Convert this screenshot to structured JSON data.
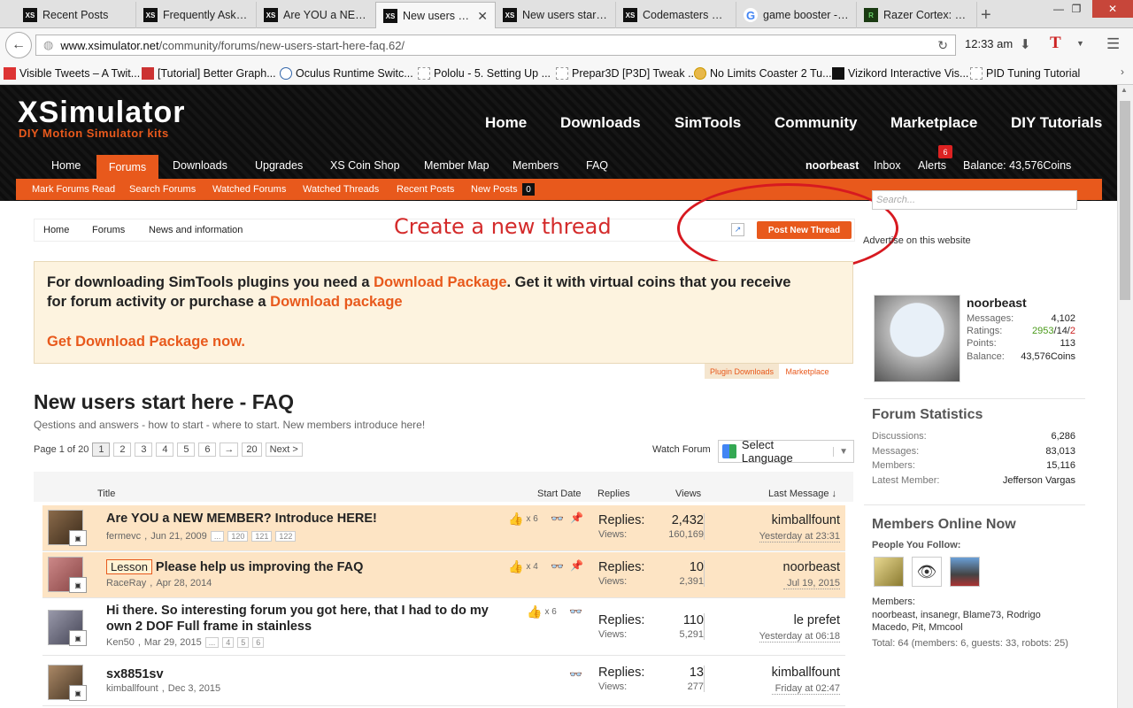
{
  "browser": {
    "tabs": [
      {
        "label": "Recent Posts",
        "icon": "XS"
      },
      {
        "label": "Frequently Aske...",
        "icon": "XS"
      },
      {
        "label": "Are YOU a NEW ...",
        "icon": "XS"
      },
      {
        "label": "New users s...",
        "icon": "XS",
        "active": true
      },
      {
        "label": "New users start ...",
        "icon": "XS"
      },
      {
        "label": "Codemasters Di...",
        "icon": "XS"
      },
      {
        "label": "game booster - ...",
        "icon": "G"
      },
      {
        "label": "Razer Cortex: Ga...",
        "icon": "R"
      }
    ],
    "url_domain": "www.xsimulator.net",
    "url_path": "/community/forums/new-users-start-here-faq.62/",
    "time": "12:33 am",
    "bookmarks": [
      "Visible Tweets – A Twit...",
      "[Tutorial] Better Graph...",
      "Oculus Runtime Switc...",
      "Pololu - 5. Setting Up ...",
      "Prepar3D [P3D] Tweak ...",
      "No Limits Coaster 2 Tu...",
      "Vizikord Interactive Vis...",
      "PID Tuning Tutorial"
    ]
  },
  "site": {
    "logo": "XSimulator",
    "tagline": "DIY Motion Simulator kits",
    "topnav": [
      "Home",
      "Downloads",
      "SimTools",
      "Community",
      "Marketplace",
      "DIY Tutorials"
    ],
    "subnav": [
      "Home",
      "Forums",
      "Downloads",
      "Upgrades",
      "XS Coin Shop",
      "Member Map",
      "Members",
      "FAQ"
    ],
    "user": "noorbeast",
    "inbox": "Inbox",
    "alerts": "Alerts",
    "alerts_count": "6",
    "balance": "Balance: 43,576Coins",
    "orange_links": [
      "Mark Forums Read",
      "Search Forums",
      "Watched Forums",
      "Watched Threads",
      "Recent Posts",
      "New Posts"
    ],
    "new_posts_count": "0"
  },
  "breadcrumb": [
    "Home",
    "Forums",
    "News and information"
  ],
  "annotation": "Create a new thread",
  "post_new_thread": "Post New Thread",
  "notice": {
    "line1_a": "For downloading SimTools plugins you need a ",
    "line1_link": "Download Package",
    "line1_b": ". Get it with virtual coins that you receive",
    "line2_a": "for forum activity or purchase a ",
    "line2_link": "Download package",
    "line3": "Get Download Package now.",
    "tab1": "Plugin Downloads",
    "tab2": "Marketplace"
  },
  "forum": {
    "title": "New users start here - FAQ",
    "description": "Qestions and answers - how to start - where to start. New members introduce here!",
    "page_info": "Page 1 of 20",
    "pages": [
      "1",
      "2",
      "3",
      "4",
      "5",
      "6",
      "→",
      "20",
      "Next >"
    ],
    "watch": "Watch Forum",
    "language": "Select Language",
    "columns": {
      "title": "Title",
      "start_date": "Start Date",
      "replies": "Replies",
      "views": "Views",
      "last": "Last Message ↓"
    }
  },
  "threads": [
    {
      "title": "Are YOU a NEW MEMBER? Introduce HERE!",
      "prefix": "",
      "line2": "",
      "author": "fermevc",
      "date": "Jun 21, 2009",
      "pages": [
        "...",
        "120",
        "121",
        "122"
      ],
      "likes": "x 6",
      "replies_label": "Replies:",
      "replies": "2,432",
      "views_label": "Views:",
      "views": "160,169",
      "last_user": "kimballfount",
      "last_date": "Yesterday at 23:31",
      "sticky": true
    },
    {
      "title": "Please help us improving the FAQ",
      "prefix": "Lesson",
      "line2": "",
      "author": "RaceRay",
      "date": "Apr 28, 2014",
      "pages": [],
      "likes": "x 4",
      "replies_label": "Replies:",
      "replies": "10",
      "views_label": "Views:",
      "views": "2,391",
      "last_user": "noorbeast",
      "last_date": "Jul 19, 2015",
      "sticky": true
    },
    {
      "title": "Hi there. So interesting forum you got here, that I had to do my",
      "prefix": "",
      "line2": "own 2 DOF Full frame in stainless",
      "author": "Ken50",
      "date": "Mar 29, 2015",
      "pages": [
        "...",
        "4",
        "5",
        "6"
      ],
      "likes": "x 6",
      "replies_label": "Replies:",
      "replies": "110",
      "views_label": "Views:",
      "views": "5,291",
      "last_user": "le prefet",
      "last_date": "Yesterday at 06:18",
      "sticky": false
    },
    {
      "title": "sx8851sv",
      "prefix": "",
      "line2": "",
      "author": "kimballfount",
      "date": "Dec 3, 2015",
      "pages": [],
      "likes": "",
      "replies_label": "Replies:",
      "replies": "13",
      "views_label": "Views:",
      "views": "277",
      "last_user": "kimballfount",
      "last_date": "Friday at 02:47",
      "sticky": false
    }
  ],
  "sidebar": {
    "search_placeholder": "Search...",
    "advertise": "Advertise on this website",
    "user": {
      "name": "noorbeast",
      "rows": [
        {
          "k": "Messages:",
          "v": "4,102"
        },
        {
          "k": "Points:",
          "v": "113"
        },
        {
          "k": "Balance:",
          "v": "43,576Coins"
        }
      ],
      "ratings_label": "Ratings:",
      "ratings_pos": "2953",
      "ratings_mid": "/14/",
      "ratings_neg": "2"
    },
    "stats_title": "Forum Statistics",
    "stats": [
      {
        "k": "Discussions:",
        "v": "6,286"
      },
      {
        "k": "Messages:",
        "v": "83,013"
      },
      {
        "k": "Members:",
        "v": "15,116"
      },
      {
        "k": "Latest Member:",
        "v": "Jefferson Vargas"
      }
    ],
    "online_title": "Members Online Now",
    "people_follow": "People You Follow:",
    "members_label": "Members:",
    "members_list": "noorbeast, insanegr, Blame73, Rodrigo Macedo, Pit, Mmcool",
    "total": "Total: 64 (members: 6, guests: 33, robots: 25)"
  }
}
